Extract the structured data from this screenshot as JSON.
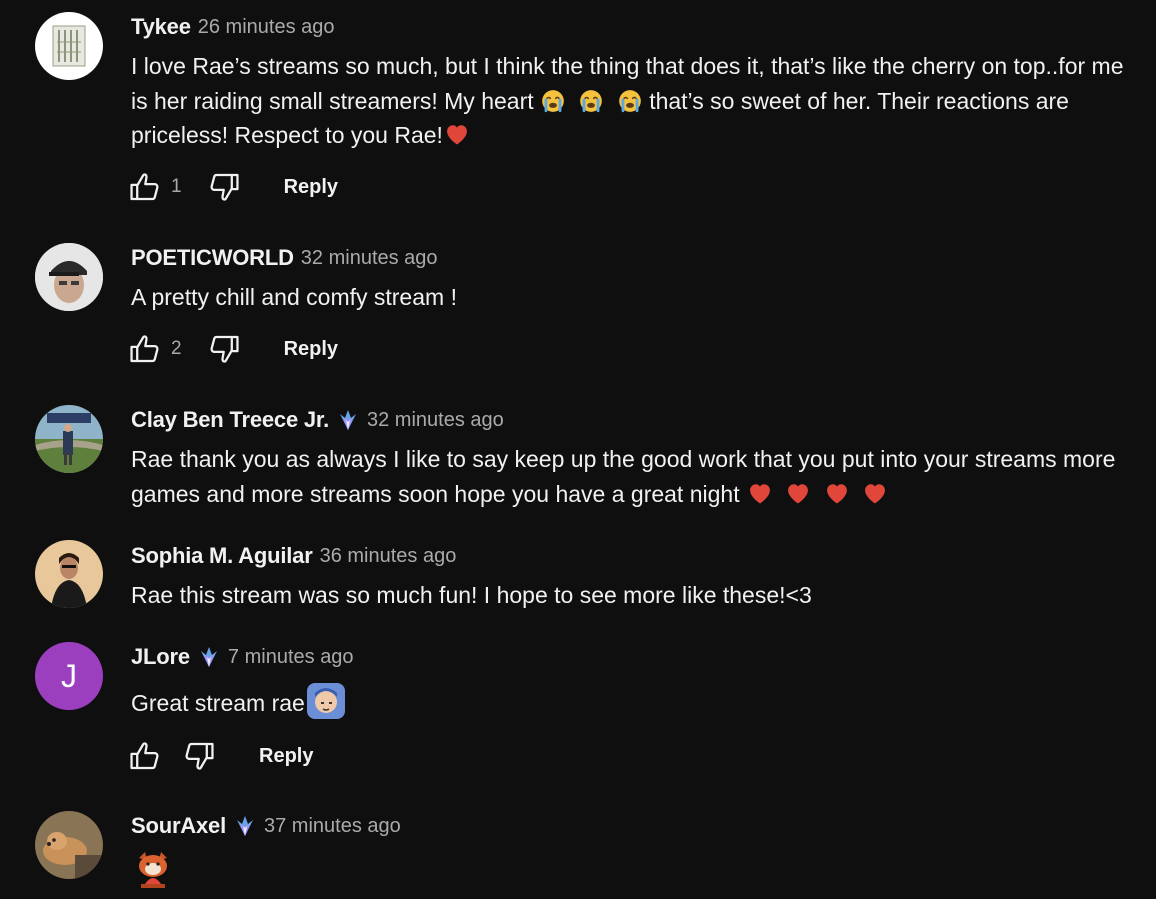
{
  "reply_label": "Reply",
  "comments": [
    {
      "author": "Tykee",
      "time": "26 minutes ago",
      "text_a": "I love Rae’s streams so much, but I think the thing that does it, that’s like the cherry on top..for me is her raiding small streamers! My heart",
      "text_b": "that’s so sweet of her. Their reactions are priceless! Respect to you Rae!",
      "likes": "1",
      "emojis": [
        "crying-face",
        "crying-face",
        "crying-face",
        "red-heart"
      ]
    },
    {
      "author": "POETICWORLD",
      "time": "32 minutes ago",
      "text": "A pretty chill and comfy stream !",
      "likes": "2"
    },
    {
      "author": "Clay Ben Treece Jr.",
      "time": "32 minutes ago",
      "text": "Rae thank you as always I like to say keep up the good work that you put into your streams more games and more streams soon hope you have a great night",
      "emojis": [
        "red-heart",
        "red-heart",
        "red-heart",
        "red-heart"
      ],
      "badge": "member-badge-icon"
    },
    {
      "author": "Sophia M. Aguilar",
      "time": "36 minutes ago",
      "text": "Rae this stream was so much fun! I hope to see more like these!<3"
    },
    {
      "author": "JLore",
      "time": "7 minutes ago",
      "text": "Great stream rae",
      "avatar_letter": "J",
      "avatar_color": "#9c3fbf",
      "badge": "member-badge-icon",
      "emojis": [
        "channel-emote"
      ]
    },
    {
      "author": "SourAxel",
      "time": "37 minutes ago",
      "badge": "member-badge-icon",
      "emojis": [
        "red-panda-emote"
      ]
    }
  ],
  "colors": {
    "background": "#0f0f0f",
    "text": "#f1f1f1",
    "secondary": "#aaaaaa",
    "heart": "#e0463a"
  }
}
